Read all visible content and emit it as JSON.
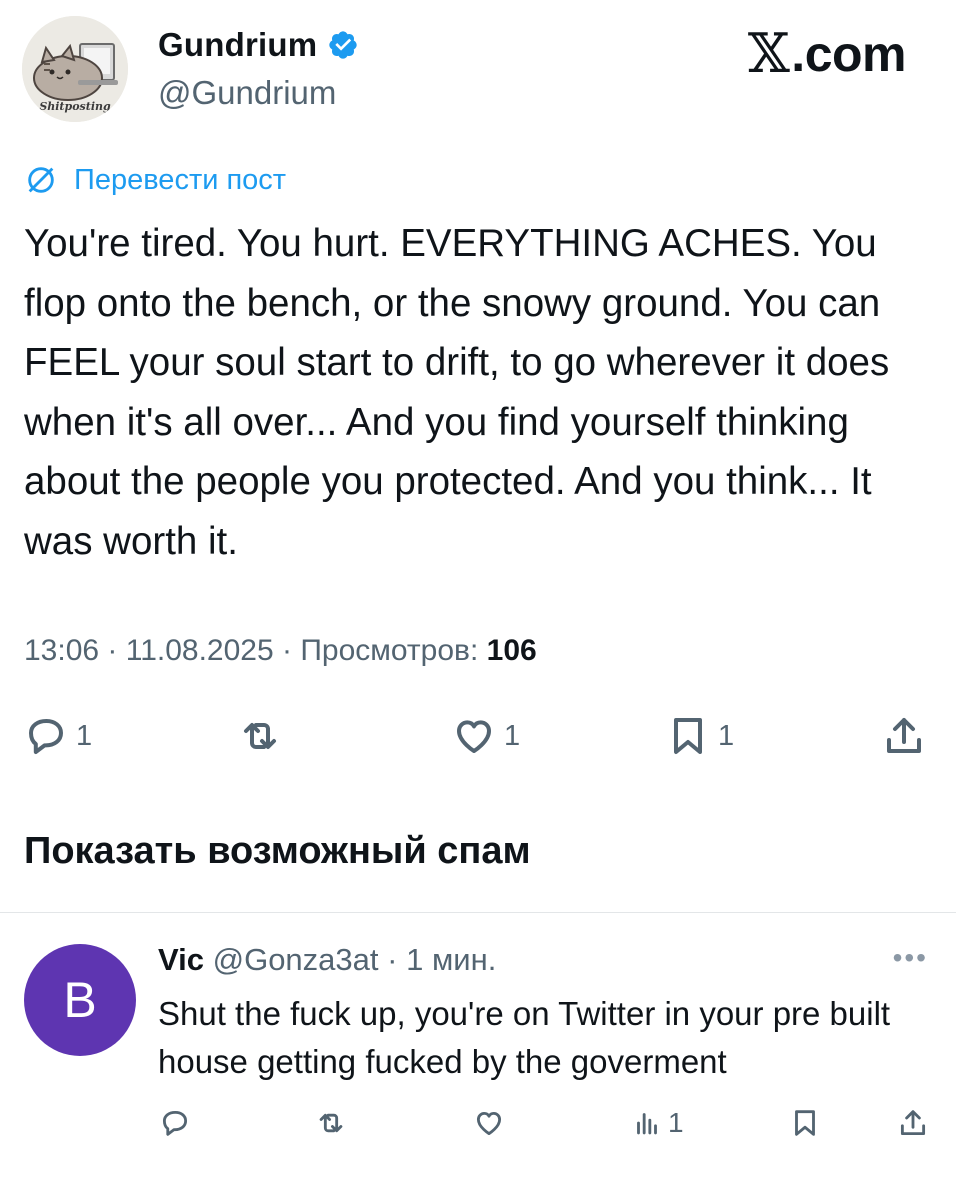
{
  "site": {
    "label": ".com",
    "logo_glyph": "𝕏"
  },
  "post": {
    "author_name": "Gundrium",
    "author_handle": "@Gundrium",
    "avatar_label": "Shitposting",
    "translate_label": "Перевести пост",
    "text": "You're tired. You hurt. EVERYTHING ACHES. You flop onto the bench, or the snowy ground. You can FEEL your soul start to drift, to go wherever it does when it's all over... And you find yourself thinking about the people you protected. And you think... It was worth it.",
    "time": "13:06",
    "date": "11.08.2025",
    "views_label": "Просмотров:",
    "views": "106",
    "counts": {
      "replies": "1",
      "likes": "1",
      "bookmarks": "1"
    }
  },
  "spam_heading": "Показать возможный спам",
  "reply": {
    "avatar_letter": "B",
    "avatar_color": "#5e35b1",
    "name": "Vic",
    "handle": "@Gonza3at",
    "time": "1 мин.",
    "text": "Shut the fuck up, you're on Twitter in your pre built house getting fucked by the goverment",
    "views": "1"
  },
  "colors": {
    "accent": "#1d9bf0",
    "muted": "#536471",
    "text": "#0f1419"
  }
}
